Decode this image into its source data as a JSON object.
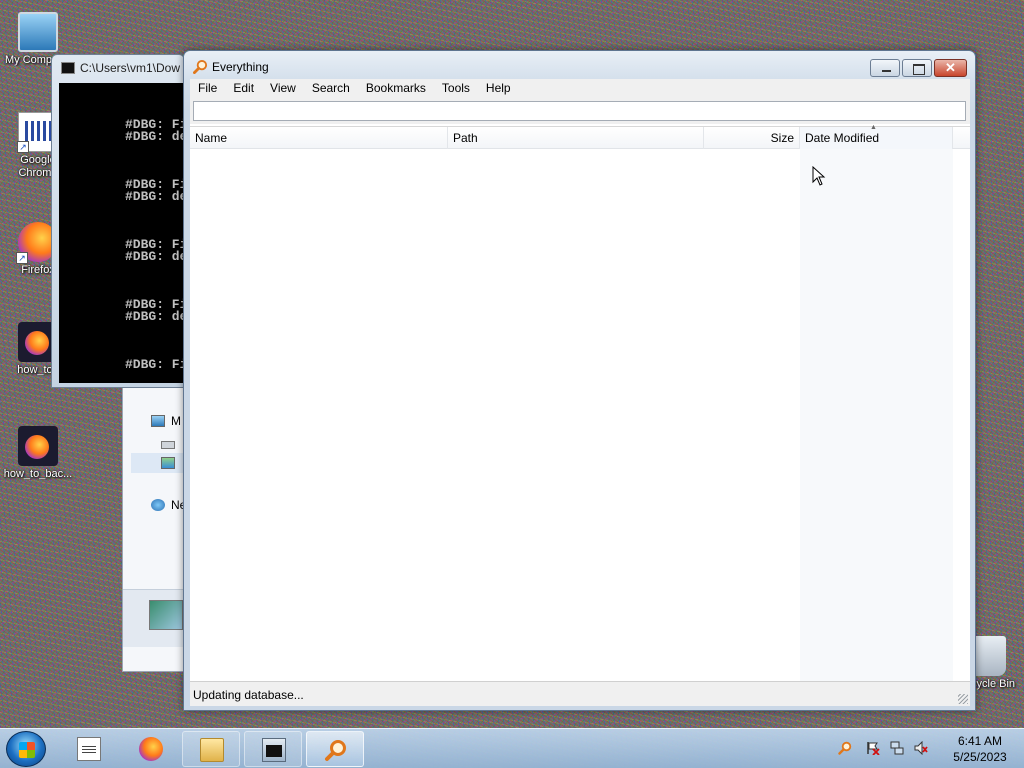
{
  "desktop": {
    "icons": [
      {
        "label": "My Computer"
      },
      {
        "label": "Google Chrome"
      },
      {
        "label": "Firefox"
      },
      {
        "label": "how_to_"
      },
      {
        "label": "how_to_bac..."
      },
      {
        "label": "Recycle Bin"
      }
    ]
  },
  "explorer": {
    "nav_items": [
      {
        "label": "M"
      },
      {
        "label": "Ne"
      }
    ]
  },
  "console": {
    "title": "C:\\Users\\vm1\\Dow",
    "lines": [
      "#DBG: Fi",
      "#DBG: de",
      "#DBG: Fi",
      "#DBG: de",
      "#DBG: Fi",
      "#DBG: de",
      "#DBG: Fi",
      "#DBG: de",
      "#DBG: Fi"
    ]
  },
  "everything": {
    "title": "Everything",
    "menu": [
      "File",
      "Edit",
      "View",
      "Search",
      "Bookmarks",
      "Tools",
      "Help"
    ],
    "search": {
      "value": "",
      "placeholder": ""
    },
    "columns": {
      "name": "Name",
      "path": "Path",
      "size": "Size",
      "date_modified": "Date Modified"
    },
    "status": "Updating database...",
    "window_buttons": {
      "minimize": "",
      "maximize": "",
      "close": "✕"
    }
  },
  "taskbar": {
    "clock": {
      "time": "6:41 AM",
      "date": "5/25/2023"
    },
    "programs": [
      "notepad",
      "firefox",
      "explorer",
      "console",
      "everything"
    ],
    "active": "everything"
  },
  "colors": {
    "title_text": "#000000",
    "close_button": "#c8452c",
    "taskbar": "#a9c6e3"
  }
}
